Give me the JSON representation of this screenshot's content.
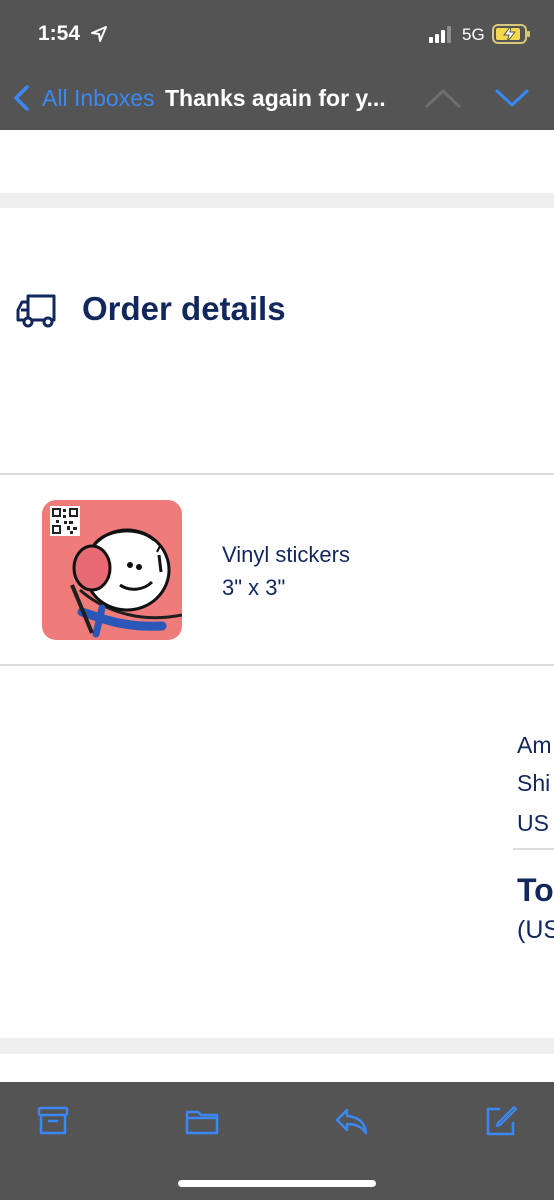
{
  "status_bar": {
    "time": "1:54",
    "network": "5G",
    "icons": [
      "location-arrow-icon",
      "signal-bars-icon",
      "battery-charging-icon"
    ]
  },
  "nav": {
    "back_label": "All Inboxes",
    "title": "Thanks again for y...",
    "icons": [
      "back-chevron-icon",
      "previous-message-icon",
      "next-message-icon"
    ]
  },
  "order": {
    "section_title": "Order details",
    "section_icon": "delivery-truck-icon",
    "item": {
      "name": "Vinyl stickers",
      "size": "3\" x 3\""
    },
    "summary": {
      "lines": [
        "Am",
        "Shi",
        "US"
      ],
      "total_label": "To",
      "total_currency": "(US"
    }
  },
  "toolbar": {
    "icons": [
      "archive-icon",
      "folder-icon",
      "reply-icon",
      "compose-icon"
    ]
  },
  "colors": {
    "bar_background": "#545454",
    "accent_blue": "#3b88f5",
    "text_navy": "#12285c",
    "thumbnail_pink": "#ef7b7a",
    "separator": "#dcdcdc",
    "band_gray": "#efefef"
  }
}
